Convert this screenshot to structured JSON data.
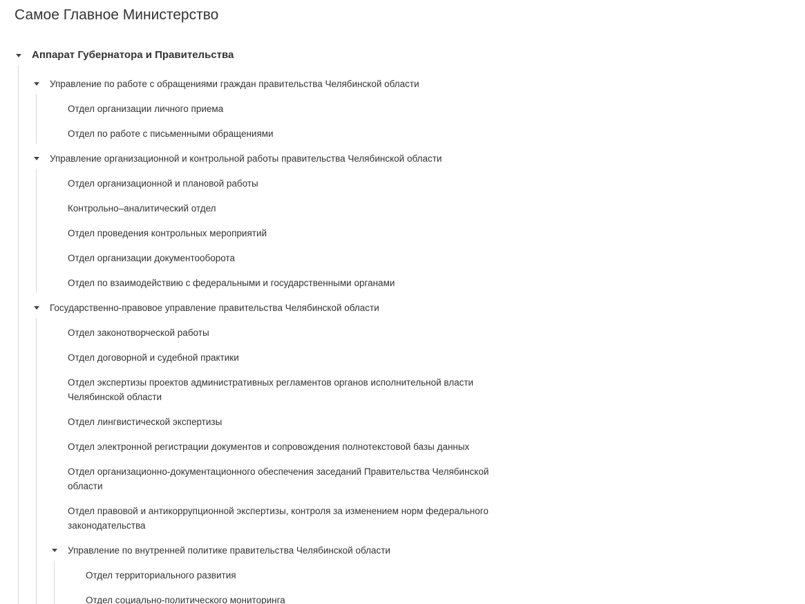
{
  "page": {
    "title": "Самое Главное Министерство"
  },
  "tree": {
    "root": {
      "label": "Аппарат Губернатора и Правительства",
      "expanded": true,
      "children": [
        {
          "label": "Управление по работе с обращениями граждан правительства Челябинской области",
          "expanded": true,
          "children": [
            {
              "label": "Отдел организации личного приема"
            },
            {
              "label": "Отдел по работе с письменными обращениями"
            }
          ]
        },
        {
          "label": "Управление организационной и контрольной работы правительства Челябинской области",
          "expanded": true,
          "children": [
            {
              "label": "Отдел организационной и плановой работы"
            },
            {
              "label": "Контрольно–аналитический отдел"
            },
            {
              "label": "Отдел проведения контрольных мероприятий"
            },
            {
              "label": "Отдел организации документооборота"
            },
            {
              "label": "Отдел по взаимодействию с федеральными и государственными органами"
            }
          ]
        },
        {
          "label": "Государственно-правовое управление правительства Челябинской области",
          "expanded": true,
          "children": [
            {
              "label": "Отдел законотворческой работы"
            },
            {
              "label": "Отдел договорной и судебной практики"
            },
            {
              "label": "Отдел экспертизы проектов административных регламентов органов исполнительной власти Челябинской области"
            },
            {
              "label": "Отдел лингвистической экспертизы"
            },
            {
              "label": "Отдел электронной регистрации документов и сопровождения полнотекстовой базы данных"
            },
            {
              "label": "Отдел организационно-документационного обеспечения заседаний Правительства Челябинской области"
            },
            {
              "label": "Отдел правовой и антикоррупционной экспертизы, контроля за изменением норм федерального законодательства"
            },
            {
              "label": "Управление по внутренней политике правительства Челябинской области",
              "expanded": true,
              "children": [
                {
                  "label": "Отдел территориального развития"
                },
                {
                  "label": "Отдел социально-политического мониторинга"
                }
              ]
            }
          ]
        }
      ]
    }
  },
  "icons": {
    "expand": "caret-down-icon"
  },
  "colors": {
    "text": "#333333",
    "guide": "#d9d9d9",
    "caret": "#444444"
  }
}
